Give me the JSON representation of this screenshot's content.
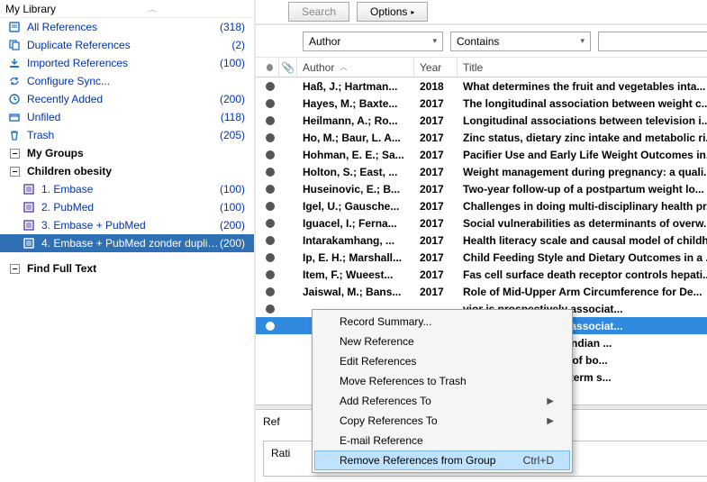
{
  "sidebar": {
    "title": "My Library",
    "items": [
      {
        "name": "all-references",
        "label": "All References",
        "count": "318",
        "icon": "book",
        "color": "#1e73c8"
      },
      {
        "name": "duplicate-references",
        "label": "Duplicate References",
        "count": "2",
        "icon": "copy",
        "color": "#1e73c8"
      },
      {
        "name": "imported-references",
        "label": "Imported References",
        "count": "100",
        "icon": "import",
        "color": "#1e73c8"
      },
      {
        "name": "configure-sync",
        "label": "Configure Sync...",
        "count": null,
        "icon": "sync",
        "color": "#1e73c8"
      },
      {
        "name": "recently-added",
        "label": "Recently Added",
        "count": "200",
        "icon": "clock",
        "color": "#1e73c8"
      },
      {
        "name": "unfiled",
        "label": "Unfiled",
        "count": "118",
        "icon": "box",
        "color": "#1e73c8"
      },
      {
        "name": "trash",
        "label": "Trash",
        "count": "205",
        "icon": "trash",
        "color": "#1e73c8"
      }
    ],
    "groups_header": "My Groups",
    "children_header": "Children obesity",
    "groups": [
      {
        "name": "group-embase",
        "label": "1. Embase",
        "count": "100",
        "selected": false
      },
      {
        "name": "group-pubmed",
        "label": "2. PubMed",
        "count": "100",
        "selected": false
      },
      {
        "name": "group-embase-pubmed",
        "label": "3. Embase + PubMed",
        "count": "200",
        "selected": false
      },
      {
        "name": "group-embase-pubmed-nodup",
        "label": "4. Embase + PubMed zonder duplic...",
        "count": "200",
        "selected": true
      }
    ],
    "find_full_text": "Find Full Text"
  },
  "toolbar": {
    "search": "Search",
    "options": "Options"
  },
  "filter": {
    "field": "Author",
    "op": "Contains"
  },
  "columns": {
    "author": "Author",
    "year": "Year",
    "title": "Title"
  },
  "rows": [
    {
      "author": "Haß, J.; Hartman...",
      "year": "2018",
      "title": "What determines the fruit and vegetables inta...",
      "sel": false
    },
    {
      "author": "Hayes, M.; Baxte...",
      "year": "2017",
      "title": "The longitudinal association between weight c...",
      "sel": false
    },
    {
      "author": "Heilmann, A.; Ro...",
      "year": "2017",
      "title": "Longitudinal associations between television i...",
      "sel": false
    },
    {
      "author": "Ho, M.; Baur, L. A...",
      "year": "2017",
      "title": "Zinc status, dietary zinc intake and metabolic ri...",
      "sel": false
    },
    {
      "author": "Hohman, E. E.; Sa...",
      "year": "2017",
      "title": "Pacifier Use and Early Life Weight Outcomes in...",
      "sel": false
    },
    {
      "author": "Holton, S.; East, ...",
      "year": "2017",
      "title": "Weight management during pregnancy: a quali...",
      "sel": false
    },
    {
      "author": "Huseinovic, E.; B...",
      "year": "2017",
      "title": "Two-year follow-up of a postpartum weight lo...",
      "sel": false
    },
    {
      "author": "Igel, U.; Gausche...",
      "year": "2017",
      "title": "Challenges in doing multi-disciplinary health pr...",
      "sel": false
    },
    {
      "author": "Iguacel, I.; Ferna...",
      "year": "2017",
      "title": "Social vulnerabilities as determinants of overw...",
      "sel": false
    },
    {
      "author": "Intarakamhang, ...",
      "year": "2017",
      "title": "Health literacy scale and causal model of childh...",
      "sel": false
    },
    {
      "author": "Ip, E. H.; Marshall...",
      "year": "2017",
      "title": "Child Feeding Style and Dietary Outcomes in a ...",
      "sel": false
    },
    {
      "author": "Item, F.; Wueest...",
      "year": "2017",
      "title": "Fas cell surface death receptor controls hepati...",
      "sel": false
    },
    {
      "author": "Jaiswal, M.; Bans...",
      "year": "2017",
      "title": "Role of Mid-Upper Arm Circumference for De...",
      "sel": false
    },
    {
      "author": "",
      "year": "",
      "title": "vior is prospectively associat...",
      "sel": false,
      "partial_top": true
    },
    {
      "author": "",
      "year": "",
      "title": "vior is prospectively associat...",
      "sel": true
    },
    {
      "author": "",
      "year": "",
      "title": "e Healthiness of the Indian ...",
      "sel": false,
      "partial": true
    },
    {
      "author": "",
      "year": "",
      "title": "limitation for the use of bo...",
      "sel": false,
      "partial": true
    },
    {
      "author": "",
      "year": "",
      "title": "liver disease in long-term s...",
      "sel": false,
      "partial": true
    },
    {
      "author": "",
      "year": "",
      "title": "",
      "sel": false,
      "partial": true
    }
  ],
  "bottom": {
    "ref_label": "Ref",
    "rating_label": "Rati"
  },
  "contextmenu": {
    "items": [
      {
        "label": "Record Summary...",
        "arrow": false
      },
      {
        "label": "New Reference",
        "arrow": false
      },
      {
        "label": "Edit References",
        "arrow": false
      },
      {
        "label": "Move References to Trash",
        "arrow": false
      },
      {
        "label": "Add References To",
        "arrow": true
      },
      {
        "label": "Copy References To",
        "arrow": true
      },
      {
        "label": "E-mail Reference",
        "arrow": false
      },
      {
        "label": "Remove References from Group",
        "arrow": false,
        "accel": "Ctrl+D",
        "hover": true
      }
    ]
  }
}
